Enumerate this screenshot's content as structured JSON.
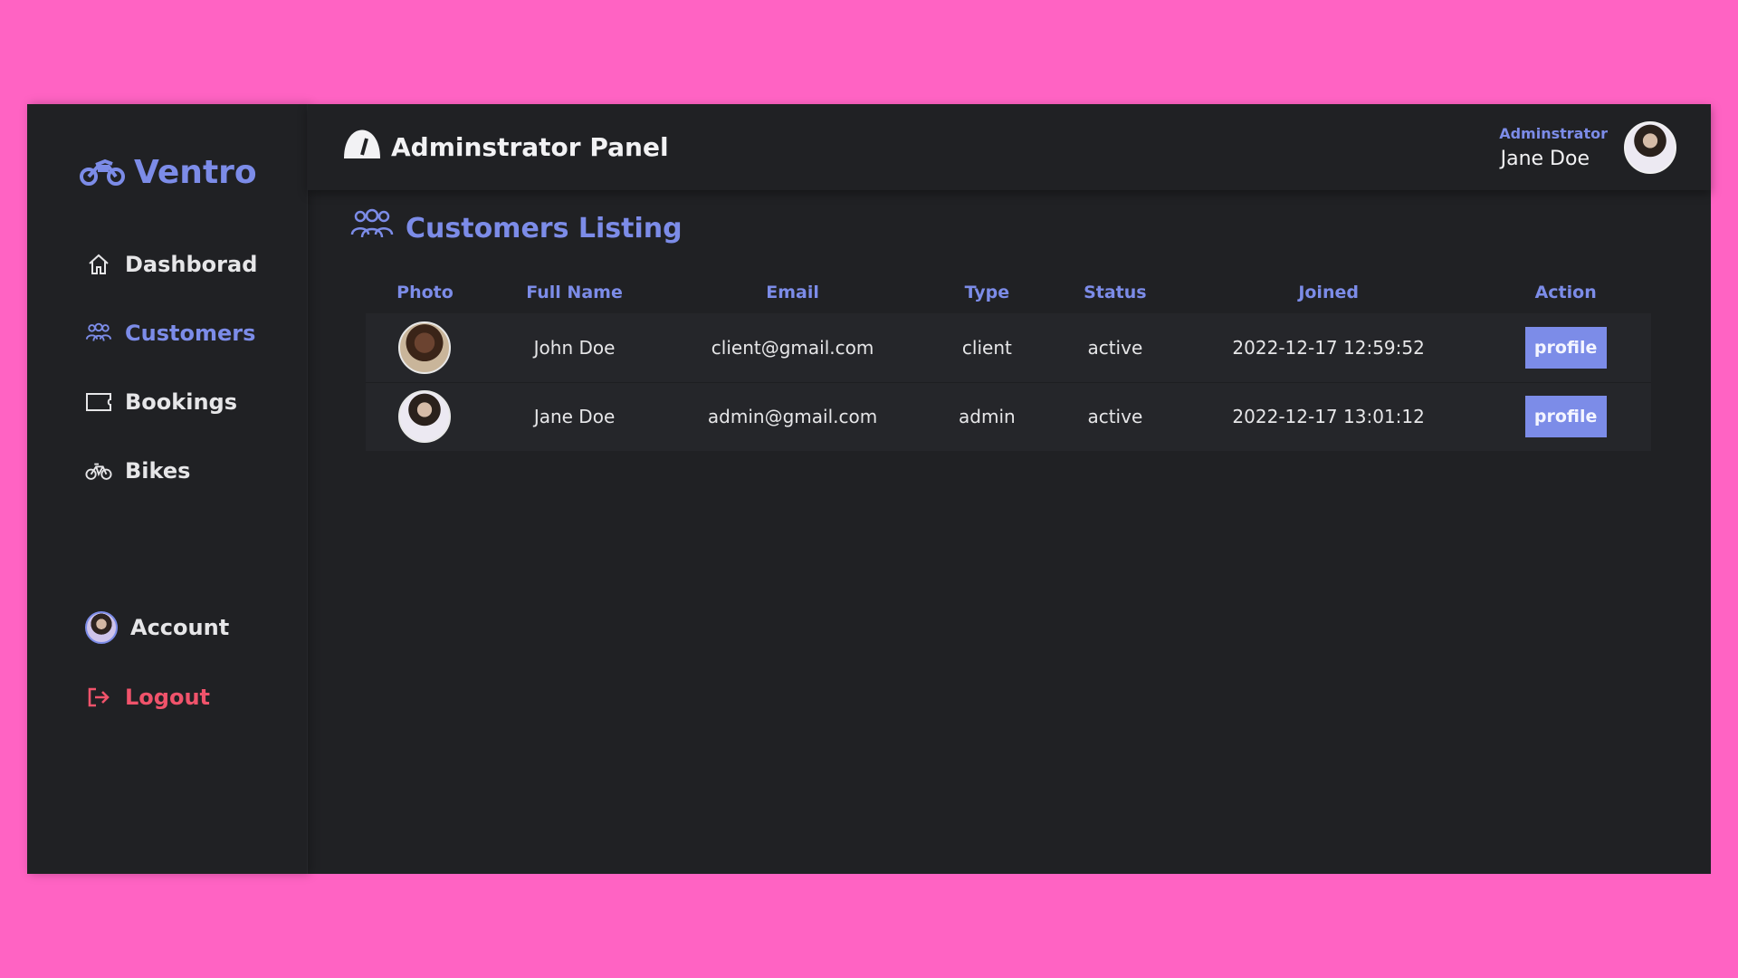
{
  "brand": {
    "name": "Ventro"
  },
  "sidebar": {
    "items": [
      {
        "label": "Dashborad",
        "icon": "home-icon"
      },
      {
        "label": "Customers",
        "icon": "users-icon",
        "active": true
      },
      {
        "label": "Bookings",
        "icon": "ticket-icon"
      },
      {
        "label": "Bikes",
        "icon": "bicycle-icon"
      }
    ],
    "account_label": "Account",
    "logout_label": "Logout"
  },
  "header": {
    "title": "Adminstrator Panel",
    "user_role": "Adminstrator",
    "user_name": "Jane Doe"
  },
  "main": {
    "section_title": "Customers Listing",
    "columns": [
      "Photo",
      "Full Name",
      "Email",
      "Type",
      "Status",
      "Joined",
      "Action"
    ],
    "rows": [
      {
        "name": "John Doe",
        "email": "client@gmail.com",
        "type": "client",
        "status": "active",
        "joined": "2022-12-17 12:59:52",
        "action": "profile"
      },
      {
        "name": "Jane Doe",
        "email": "admin@gmail.com",
        "type": "admin",
        "status": "active",
        "joined": "2022-12-17 13:01:12",
        "action": "profile"
      }
    ]
  },
  "colors": {
    "background": "#ff63c3",
    "panel": "#202124",
    "accent": "#7c8ce8",
    "logout": "#f0536b"
  }
}
